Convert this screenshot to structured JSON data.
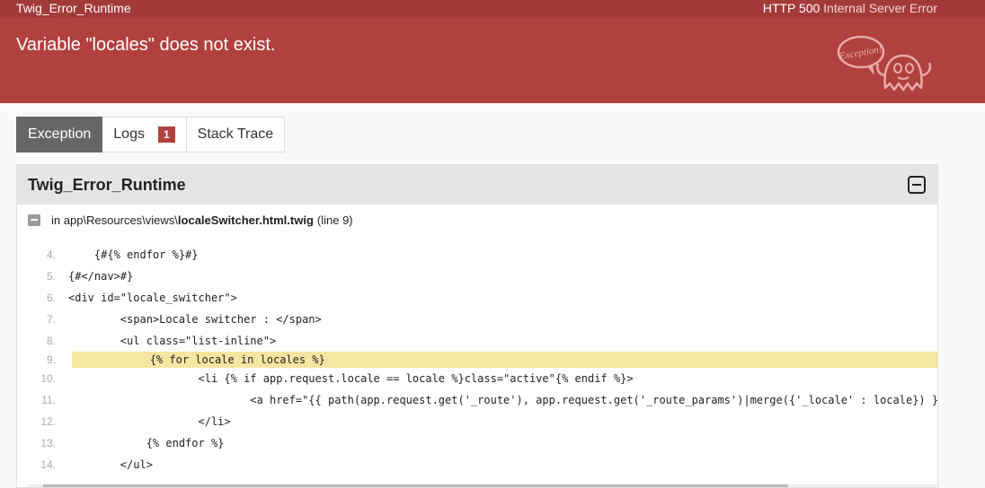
{
  "topbar": {
    "exception_class": "Twig_Error_Runtime",
    "status_code": "HTTP 500",
    "status_text": "Internal Server Error"
  },
  "header": {
    "message": "Variable \"locales\" does not exist.",
    "logo_text": "Exception!"
  },
  "tabs": [
    {
      "label": "Exception",
      "active": true
    },
    {
      "label": "Logs",
      "badge": "1",
      "active": false
    },
    {
      "label": "Stack Trace",
      "active": false
    }
  ],
  "panel": {
    "title": "Twig_Error_Runtime",
    "trace": {
      "prefix": "in app\\Resources\\views\\",
      "file": "localeSwitcher.html.twig",
      "line_info": "(line 9)"
    },
    "code_lines": [
      {
        "num": "4.",
        "code": "    {#{% endfor %}#}"
      },
      {
        "num": "5.",
        "code": "{#</nav>#}"
      },
      {
        "num": "6.",
        "code": "<div id=\"locale_switcher\">"
      },
      {
        "num": "7.",
        "code": "        <span>Locale switcher : </span>"
      },
      {
        "num": "8.",
        "code": "        <ul class=\"list-inline\">"
      },
      {
        "num": "9.",
        "code": "            {% for locale in locales %}",
        "highlight": true
      },
      {
        "num": "10.",
        "code": "                    <li {% if app.request.locale == locale %}class=\"active\"{% endif %}>"
      },
      {
        "num": "11.",
        "code": "                            <a href=\"{{ path(app.request.get('_route'), app.request.get('_route_params')|merge({'_locale' : locale}) }}\">{{ locale }}</a>"
      },
      {
        "num": "12.",
        "code": "                    </li>"
      },
      {
        "num": "13.",
        "code": "            {% endfor %}"
      },
      {
        "num": "14.",
        "code": "        </ul>"
      }
    ]
  },
  "colors": {
    "topbar": "#a33a3a",
    "header": "#b0413e",
    "highlight": "#f7e5a2",
    "active_tab": "#666666"
  }
}
